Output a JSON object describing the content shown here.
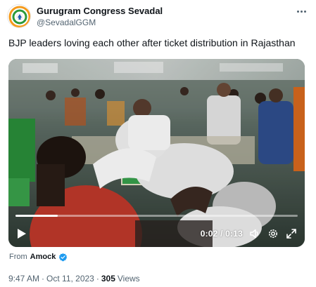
{
  "author": {
    "display_name": "Gurugram Congress Sevadal",
    "handle": "@SevadalGGM",
    "avatar_icon": "congress-sevadal-logo-icon"
  },
  "tweet": {
    "text": "BJP leaders loving each other after ticket distribution in Rajasthan"
  },
  "video": {
    "current_time": "0:02",
    "duration": "0:13",
    "progress_fraction": 0.15,
    "icons": [
      "play-icon",
      "volume-icon",
      "settings-icon",
      "fullscreen-icon"
    ]
  },
  "attribution": {
    "from_label": "From",
    "source_name": "Amock",
    "verified_icon": "verified-badge-icon"
  },
  "meta": {
    "time": "9:47 AM",
    "separator": "·",
    "date": "Oct 11, 2023",
    "views_count": "305",
    "views_label": "Views"
  },
  "colors": {
    "text_primary": "#0f1419",
    "text_secondary": "#536471",
    "verified_blue": "#1d9bf0"
  }
}
